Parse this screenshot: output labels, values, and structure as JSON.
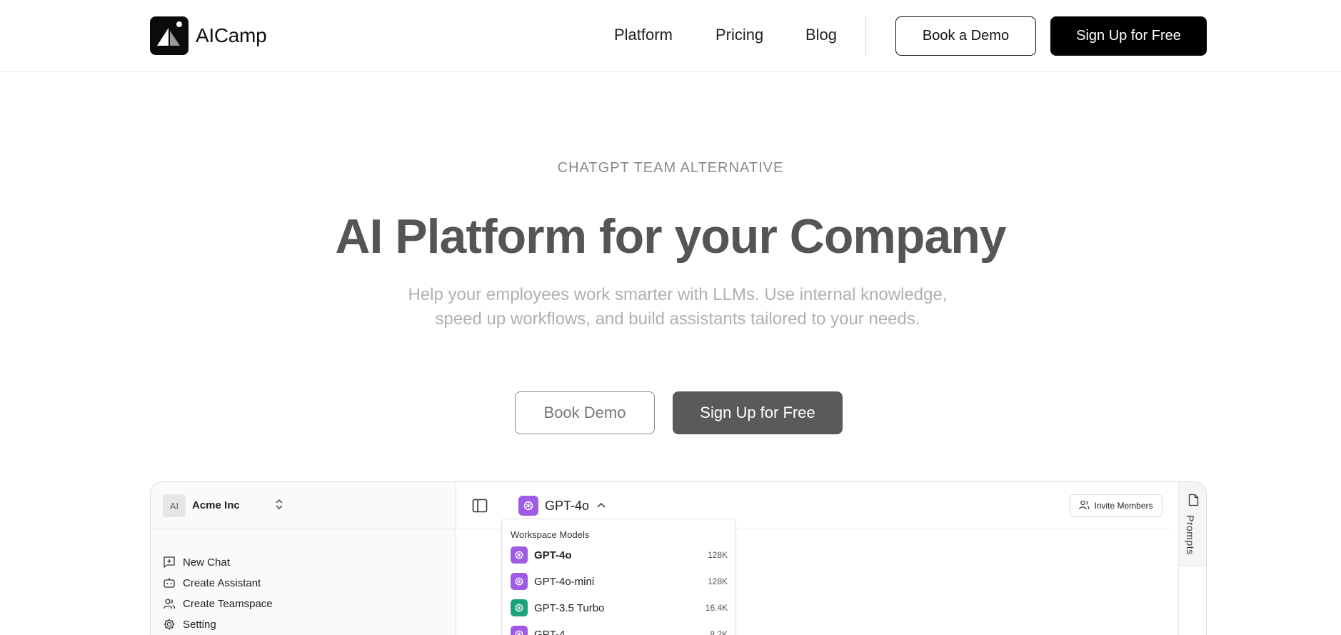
{
  "header": {
    "brand": "AICamp",
    "nav": [
      "Platform",
      "Pricing",
      "Blog"
    ],
    "book_demo": "Book a Demo",
    "sign_up": "Sign Up for Free"
  },
  "hero": {
    "eyebrow": "CHATGPT TEAM ALTERNATIVE",
    "title": "AI Platform for your Company",
    "subtitle": "Help your employees work smarter with LLMs. Use internal knowledge, speed up workflows, and build assistants tailored to your needs.",
    "book_demo": "Book Demo",
    "sign_up": "Sign Up for Free"
  },
  "app": {
    "workspace_avatar": "AI",
    "workspace_name": "Acme Inc",
    "sidebar_items": [
      "New Chat",
      "Create Assistant",
      "Create Teamspace",
      "Setting"
    ],
    "current_model": "GPT-4o",
    "invite": "Invite Members",
    "dropdown_title": "Workspace Models",
    "models": [
      {
        "name": "GPT-4o",
        "ctx": "128K",
        "color": "#a05be6",
        "bold": true
      },
      {
        "name": "GPT-4o-mini",
        "ctx": "128K",
        "color": "#a05be6"
      },
      {
        "name": "GPT-3.5 Turbo",
        "ctx": "16.4K",
        "color": "#19a37c"
      },
      {
        "name": "GPT-4",
        "ctx": "8.2K",
        "color": "#a05be6"
      }
    ],
    "prompts_label": "Prompts"
  },
  "colors": {
    "accent_purple": "#a05be6",
    "accent_green": "#19a37c",
    "black": "#000000"
  }
}
